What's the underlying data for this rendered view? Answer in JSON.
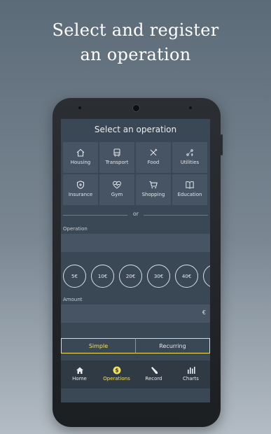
{
  "promo": {
    "line1": "Select and register",
    "line2": "an operation"
  },
  "screen": {
    "title": "Select an operation",
    "categories": [
      {
        "label": "Housing",
        "icon": "house-icon"
      },
      {
        "label": "Transport",
        "icon": "bus-icon"
      },
      {
        "label": "Food",
        "icon": "fork-knife-icon"
      },
      {
        "label": "Utilities",
        "icon": "utilities-icon"
      },
      {
        "label": "Insurance",
        "icon": "shield-plus-icon"
      },
      {
        "label": "Gym",
        "icon": "heart-pulse-icon"
      },
      {
        "label": "Shopping",
        "icon": "cart-icon"
      },
      {
        "label": "Education",
        "icon": "book-icon"
      }
    ],
    "or_text": "or",
    "operation_label": "Operation",
    "operation_value": "",
    "amount_options": [
      "5€",
      "10€",
      "20€",
      "30€",
      "40€",
      "5"
    ],
    "amount_label": "Amount",
    "currency_symbol": "€",
    "tabs": {
      "simple": "Simple",
      "recurring": "Recurring",
      "active": "Simple"
    },
    "nav": [
      {
        "label": "Home",
        "icon": "home-icon",
        "active": false
      },
      {
        "label": "Operations",
        "icon": "coin-icon",
        "active": true
      },
      {
        "label": "Record",
        "icon": "pencil-icon",
        "active": false
      },
      {
        "label": "Charts",
        "icon": "bars-icon",
        "active": false
      }
    ]
  },
  "colors": {
    "accent": "#f2e35b",
    "screen_bg": "#3a4754",
    "tile_bg": "#465463",
    "nav_bg": "#2f3a45",
    "phone_body": "#1c1f22"
  }
}
